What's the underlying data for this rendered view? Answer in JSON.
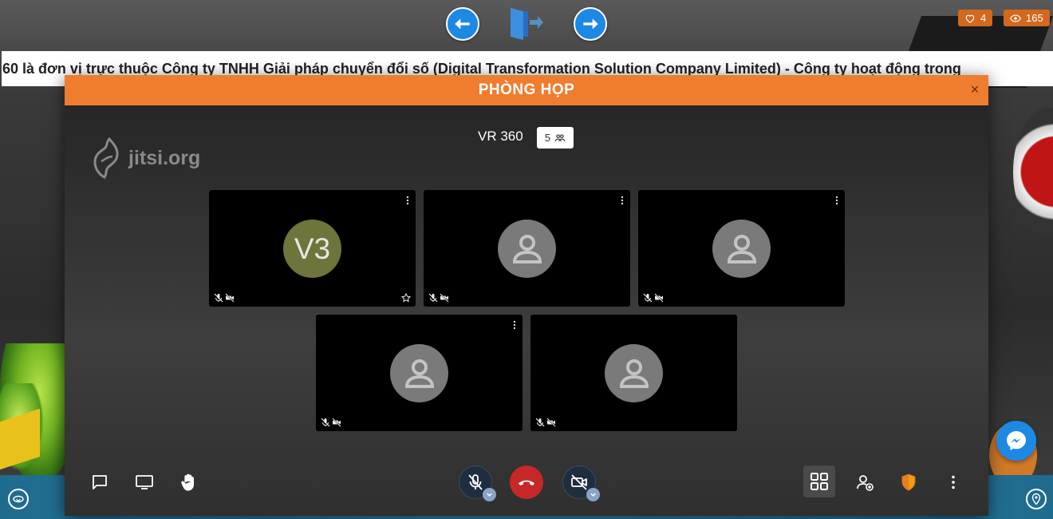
{
  "top_stats": {
    "likes": "4",
    "views": "165"
  },
  "marquee": {
    "text": "60 là đơn vị trực thuộc Công ty TNHH Giải pháp chuyển đổi số (Digital Transformation Solution Company Limited) - Công ty hoạt động trong"
  },
  "modal": {
    "title": "PHÒNG HỌP",
    "close_label": "×",
    "watermark": "jitsi.org",
    "room_name": "VR 360",
    "participant_count": "5"
  },
  "tiles": [
    {
      "initials": "V3",
      "has_star": true
    },
    {
      "initials": ""
    },
    {
      "initials": ""
    },
    {
      "initials": ""
    },
    {
      "initials": ""
    }
  ],
  "icons": {
    "back": "arrow-left-icon",
    "exit": "door-exit-icon",
    "forward": "arrow-right-icon",
    "chat": "chat-icon",
    "screen_share": "screen-share-icon",
    "raise_hand": "raise-hand-icon",
    "mic": "mic-muted-icon",
    "hangup": "hangup-icon",
    "camera": "camera-off-icon",
    "tile_view": "tile-view-icon",
    "invite": "add-participant-icon",
    "security": "shield-icon",
    "more": "more-vertical-icon",
    "messenger": "messenger-icon"
  },
  "colors": {
    "accent": "#ef7d30",
    "nav_blue": "#1e88e5",
    "hangup_red": "#c62828",
    "badge_orange": "#d2691e"
  }
}
